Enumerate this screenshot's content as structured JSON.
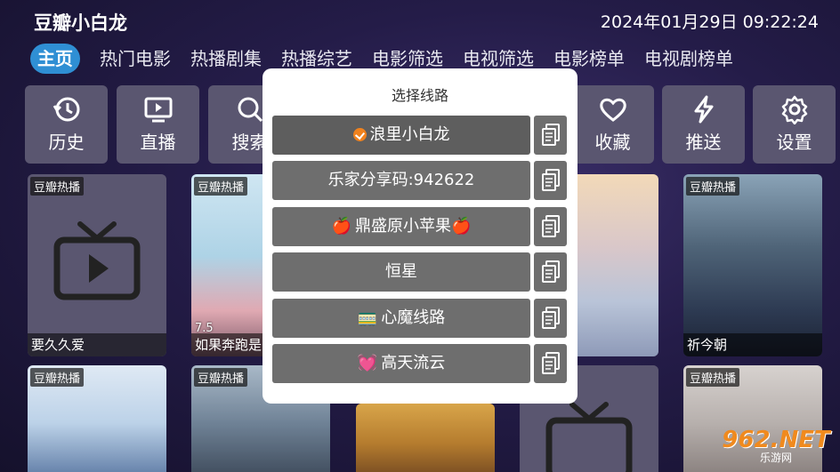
{
  "header": {
    "app_title": "豆瓣小白龙",
    "datetime": "2024年01月29日 09:22:24"
  },
  "nav": {
    "tabs": [
      "主页",
      "热门电影",
      "热播剧集",
      "热播综艺",
      "电影筛选",
      "电视筛选",
      "电影榜单",
      "电视剧榜单"
    ],
    "active_index": 0
  },
  "quick_tiles": [
    {
      "label": "历史",
      "icon": "history-icon"
    },
    {
      "label": "直播",
      "icon": "tv-icon"
    },
    {
      "label": "搜索",
      "icon": "search-icon"
    },
    {
      "label": "收藏",
      "icon": "heart-icon"
    },
    {
      "label": "推送",
      "icon": "lightning-icon"
    },
    {
      "label": "设置",
      "icon": "gear-icon"
    }
  ],
  "cards_row1": [
    {
      "badge": "豆瓣热播",
      "title": "要久久爱",
      "rating": "",
      "placeholder": true
    },
    {
      "badge": "豆瓣热播",
      "title": "如果奔跑是",
      "rating": "7.5",
      "placeholder": false
    },
    {
      "badge": "",
      "title": "",
      "rating": "",
      "placeholder": false
    },
    {
      "badge": "",
      "title": "",
      "rating": "",
      "placeholder": false
    },
    {
      "badge": "豆瓣热播",
      "title": "祈今朝",
      "rating": "",
      "placeholder": false
    }
  ],
  "cards_row2": [
    {
      "badge": "豆瓣热播",
      "placeholder": false
    },
    {
      "badge": "豆瓣热播",
      "placeholder": false
    },
    {
      "badge": "",
      "placeholder": false
    },
    {
      "badge": "",
      "placeholder": true
    },
    {
      "badge": "豆瓣热播",
      "placeholder": false
    }
  ],
  "modal": {
    "title": "选择线路",
    "routes": [
      {
        "label": "浪里小白龙",
        "prefix": "check",
        "suffix": "",
        "selected": true
      },
      {
        "label": "乐家分享码:942622",
        "prefix": "",
        "suffix": "",
        "selected": false
      },
      {
        "label": "鼎盛原小苹果",
        "prefix": "🍎",
        "suffix": "🍎",
        "selected": false
      },
      {
        "label": "恒星",
        "prefix": "",
        "suffix": "",
        "selected": false
      },
      {
        "label": "心魔线路",
        "prefix": "🚃",
        "suffix": "",
        "selected": false
      },
      {
        "label": "高天流云",
        "prefix": "💓",
        "suffix": "",
        "selected": false
      }
    ]
  },
  "watermark": {
    "main": "962.NET",
    "sub": "乐游网"
  },
  "colors": {
    "accent": "#2f8fd4",
    "check": "#f0821e",
    "route_bg": "#6e6e6e"
  }
}
